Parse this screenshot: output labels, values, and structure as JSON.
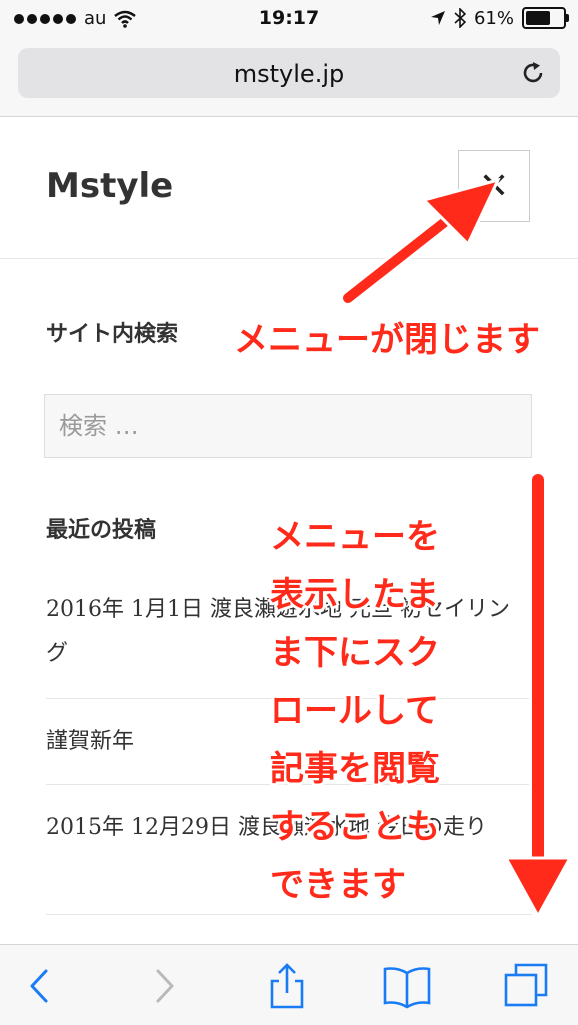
{
  "status_bar": {
    "carrier": "au",
    "time": "19:17",
    "battery_percent": "61%",
    "battery_level": 0.61,
    "icons": [
      "signal-dots-icon",
      "wifi-icon",
      "location-arrow-icon",
      "bluetooth-icon",
      "battery-icon"
    ]
  },
  "browser": {
    "url": "mstyle.jp",
    "reload_icon": "reload-icon"
  },
  "page": {
    "site_title": "Mstyle",
    "close_symbol": "✕",
    "search_heading": "サイト内検索",
    "search_placeholder": "検索 …",
    "recent_heading": "最近の投稿",
    "recent_posts": [
      "2016年 1月1日 渡良瀬遊水地 元旦 初セイリング",
      "謹賀新年",
      "2015年 12月29日 渡良瀬遊水地 今日の走り"
    ]
  },
  "annotations": {
    "close_note": "メニューが閉じます",
    "scroll_note_lines": [
      "メニューを",
      "表示したま",
      "ま下にスク",
      "ロールして",
      "記事を閲覧",
      "することも",
      "できます"
    ],
    "accent_color": "#ff2a1a"
  },
  "toolbar": {
    "icons": [
      "back-icon",
      "forward-icon",
      "share-icon",
      "bookmarks-icon",
      "tabs-icon"
    ]
  }
}
